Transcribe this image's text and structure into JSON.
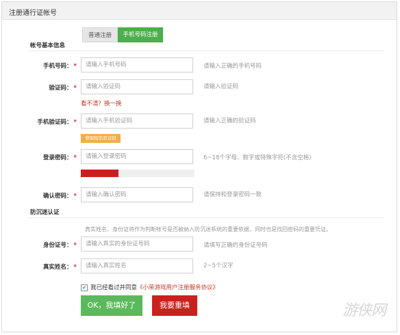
{
  "panel": {
    "title": "注册通行证帐号"
  },
  "tabs": [
    {
      "label": "普通注册",
      "active": false
    },
    {
      "label": "手机号码注册",
      "active": true
    }
  ],
  "sections": {
    "basic": "帐号基本信息",
    "anti_addiction": "防沉迷认证"
  },
  "fields": {
    "phone": {
      "label": "手机号码：",
      "required": "*",
      "placeholder": "请输入手机号码",
      "hint": "请输入正确的手机号码"
    },
    "captcha": {
      "label": "验证码：",
      "required": "*",
      "placeholder": "请输入验证码",
      "hint": "请输入验证码",
      "refresh": "看不清？换一换"
    },
    "sms_code": {
      "label": "手机验证码：",
      "required": "*",
      "placeholder": "请输入手机验证码",
      "hint": "请输入正确的验证码",
      "button": "获取短信验证码"
    },
    "password": {
      "label": "登录密码：",
      "required": "*",
      "placeholder": "请输入登录密码",
      "hint": "6~18个字母、数字或特殊字符(不含空格)",
      "strength": 0.33
    },
    "confirm": {
      "label": "确认密码：",
      "required": "*",
      "placeholder": "请输入确认密码",
      "hint": "请保持和登录密码一致"
    },
    "id_card": {
      "label": "身份证号：",
      "required": "*",
      "placeholder": "请输入真实的身份证号码",
      "hint": "请填写正确的身份证号码"
    },
    "real_name": {
      "label": "真实姓名：",
      "required": "*",
      "placeholder": "请输入真实姓名",
      "hint": "2~5个汉字"
    }
  },
  "anti_addiction_info": "真实姓名、身份证将作为判断帐号是否被纳入防沉迷系统的重要依据，同时也是找回密码的重要凭证。",
  "agreement": {
    "checked_mark": "✔",
    "text": "我已经看过并同意",
    "link": "《小荣游戏用户注册服务协议》"
  },
  "buttons": {
    "ok": "OK，我填好了",
    "reset": "我要重填"
  },
  "watermark": "游侠网"
}
